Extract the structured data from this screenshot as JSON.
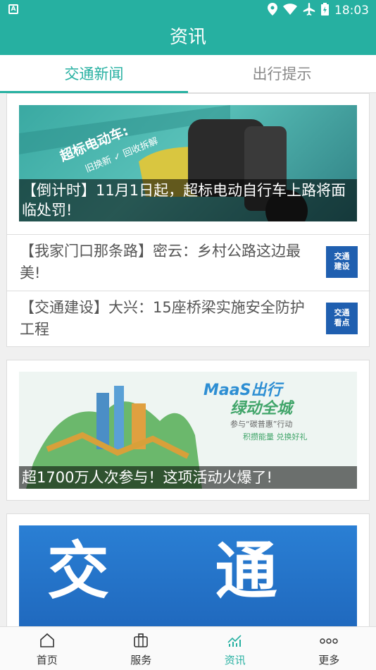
{
  "status": {
    "time": "18:03",
    "left_icon": "A"
  },
  "header": {
    "title": "资讯"
  },
  "tabs": [
    {
      "label": "交通新闻"
    },
    {
      "label": "出行提示"
    }
  ],
  "feed": {
    "banner1": {
      "caption": "【倒计时】11月1日起，超标电动自行车上路将面临处罚!",
      "image_text_a": "超标电动车:",
      "image_text_b": "旧换新 ✓ 回收拆解"
    },
    "rows": [
      {
        "text": "【我家门口那条路】密云：乡村公路这边最美!",
        "thumb": "交通\n建设"
      },
      {
        "text": "【交通建设】大兴：15座桥梁实施安全防护工程",
        "thumb": "交通\n看点"
      }
    ],
    "banner2": {
      "caption": "超1700万人次参与！这项活动火爆了!",
      "image_title_a": "MaaS出行",
      "image_title_b": "绿动全城",
      "image_sub": "参与“碳普惠”行动",
      "image_sub2": "积攒能量 兑换好礼"
    },
    "banner3": {
      "image_text": "交 通"
    }
  },
  "navbar": [
    {
      "label": "首页",
      "icon": "home-icon"
    },
    {
      "label": "服务",
      "icon": "briefcase-icon"
    },
    {
      "label": "资讯",
      "icon": "news-chart-icon"
    },
    {
      "label": "更多",
      "icon": "more-dots-icon"
    }
  ]
}
